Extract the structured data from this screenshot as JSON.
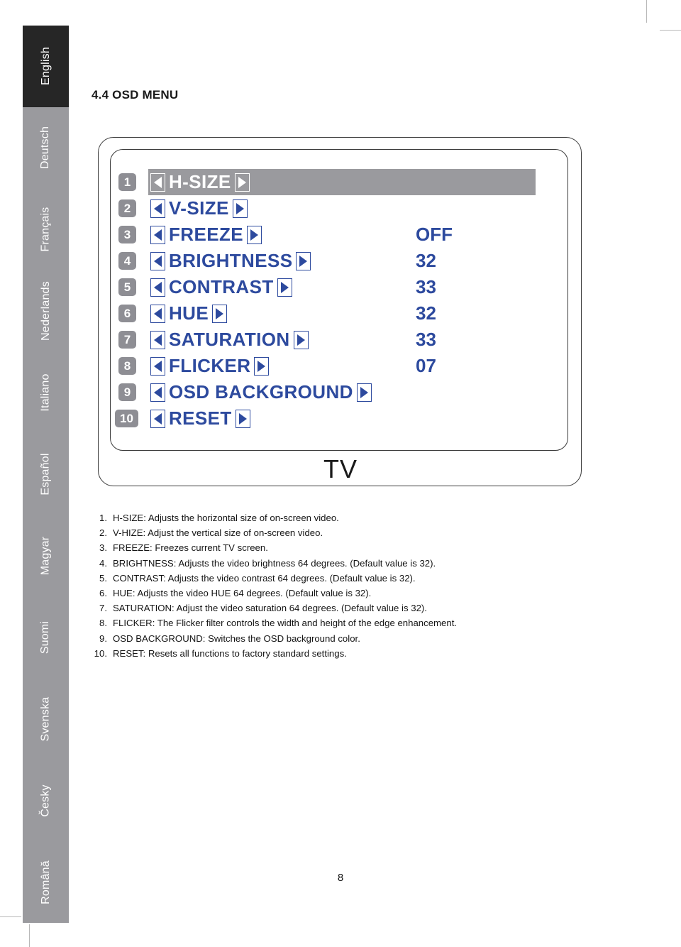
{
  "sidebar": {
    "items": [
      {
        "label": "English",
        "active": true
      },
      {
        "label": "Deutsch",
        "active": false
      },
      {
        "label": "Français",
        "active": false
      },
      {
        "label": "Nederlands",
        "active": false
      },
      {
        "label": "Italiano",
        "active": false
      },
      {
        "label": "Español",
        "active": false
      },
      {
        "label": "Magyar",
        "active": false
      },
      {
        "label": "Suomi",
        "active": false
      },
      {
        "label": "Svenska",
        "active": false
      },
      {
        "label": "Česky",
        "active": false
      },
      {
        "label": "Română",
        "active": false
      }
    ],
    "active_bg": "#262626",
    "inactive_bg": "#9a9a9e"
  },
  "heading": "4.4 OSD MENU",
  "osd": {
    "source_label": "TV",
    "highlight_color": "#9a9a9e",
    "text_color": "#2d4a9e",
    "badge_color": "#8e8e94",
    "left_arrow_icon": "triangle-left-icon",
    "right_arrow_icon": "triangle-right-icon",
    "rows": [
      {
        "num": "1",
        "label": "H-SIZE",
        "value": "",
        "highlight": true
      },
      {
        "num": "2",
        "label": "V-SIZE",
        "value": "",
        "highlight": false
      },
      {
        "num": "3",
        "label": "FREEZE",
        "value": "OFF",
        "highlight": false
      },
      {
        "num": "4",
        "label": "BRIGHTNESS",
        "value": "32",
        "highlight": false
      },
      {
        "num": "5",
        "label": "CONTRAST",
        "value": "33",
        "highlight": false
      },
      {
        "num": "6",
        "label": "HUE",
        "value": "32",
        "highlight": false
      },
      {
        "num": "7",
        "label": "SATURATION",
        "value": "33",
        "highlight": false
      },
      {
        "num": "8",
        "label": "FLICKER",
        "value": "07",
        "highlight": false
      },
      {
        "num": "9",
        "label": "OSD BACKGROUND",
        "value": "",
        "highlight": false
      },
      {
        "num": "10",
        "label": "RESET",
        "value": "",
        "highlight": false
      }
    ]
  },
  "descriptions": [
    {
      "num": "1.",
      "text": "H-SIZE: Adjusts the horizontal size of on-screen video."
    },
    {
      "num": "2.",
      "text": "V-HIZE: Adjust the vertical size of on-screen video."
    },
    {
      "num": "3.",
      "text": "FREEZE: Freezes current TV screen."
    },
    {
      "num": "4.",
      "text": "BRIGHTNESS: Adjusts the video brightness 64 degrees. (Default value is 32)."
    },
    {
      "num": "5.",
      "text": "CONTRAST: Adjusts the video contrast 64 degrees. (Default value is 32)."
    },
    {
      "num": "6.",
      "text": "HUE: Adjusts the video HUE 64 degrees. (Default value is 32)."
    },
    {
      "num": "7.",
      "text": "SATURATION: Adjust the video saturation 64 degrees. (Default value is 32)."
    },
    {
      "num": "8.",
      "text": "FLICKER: The Flicker filter controls the width and height of the edge enhancement."
    },
    {
      "num": "9.",
      "text": "OSD BACKGROUND: Switches the OSD background color."
    },
    {
      "num": "10.",
      "text": "RESET: Resets all functions to factory standard settings."
    }
  ],
  "page_number": "8"
}
